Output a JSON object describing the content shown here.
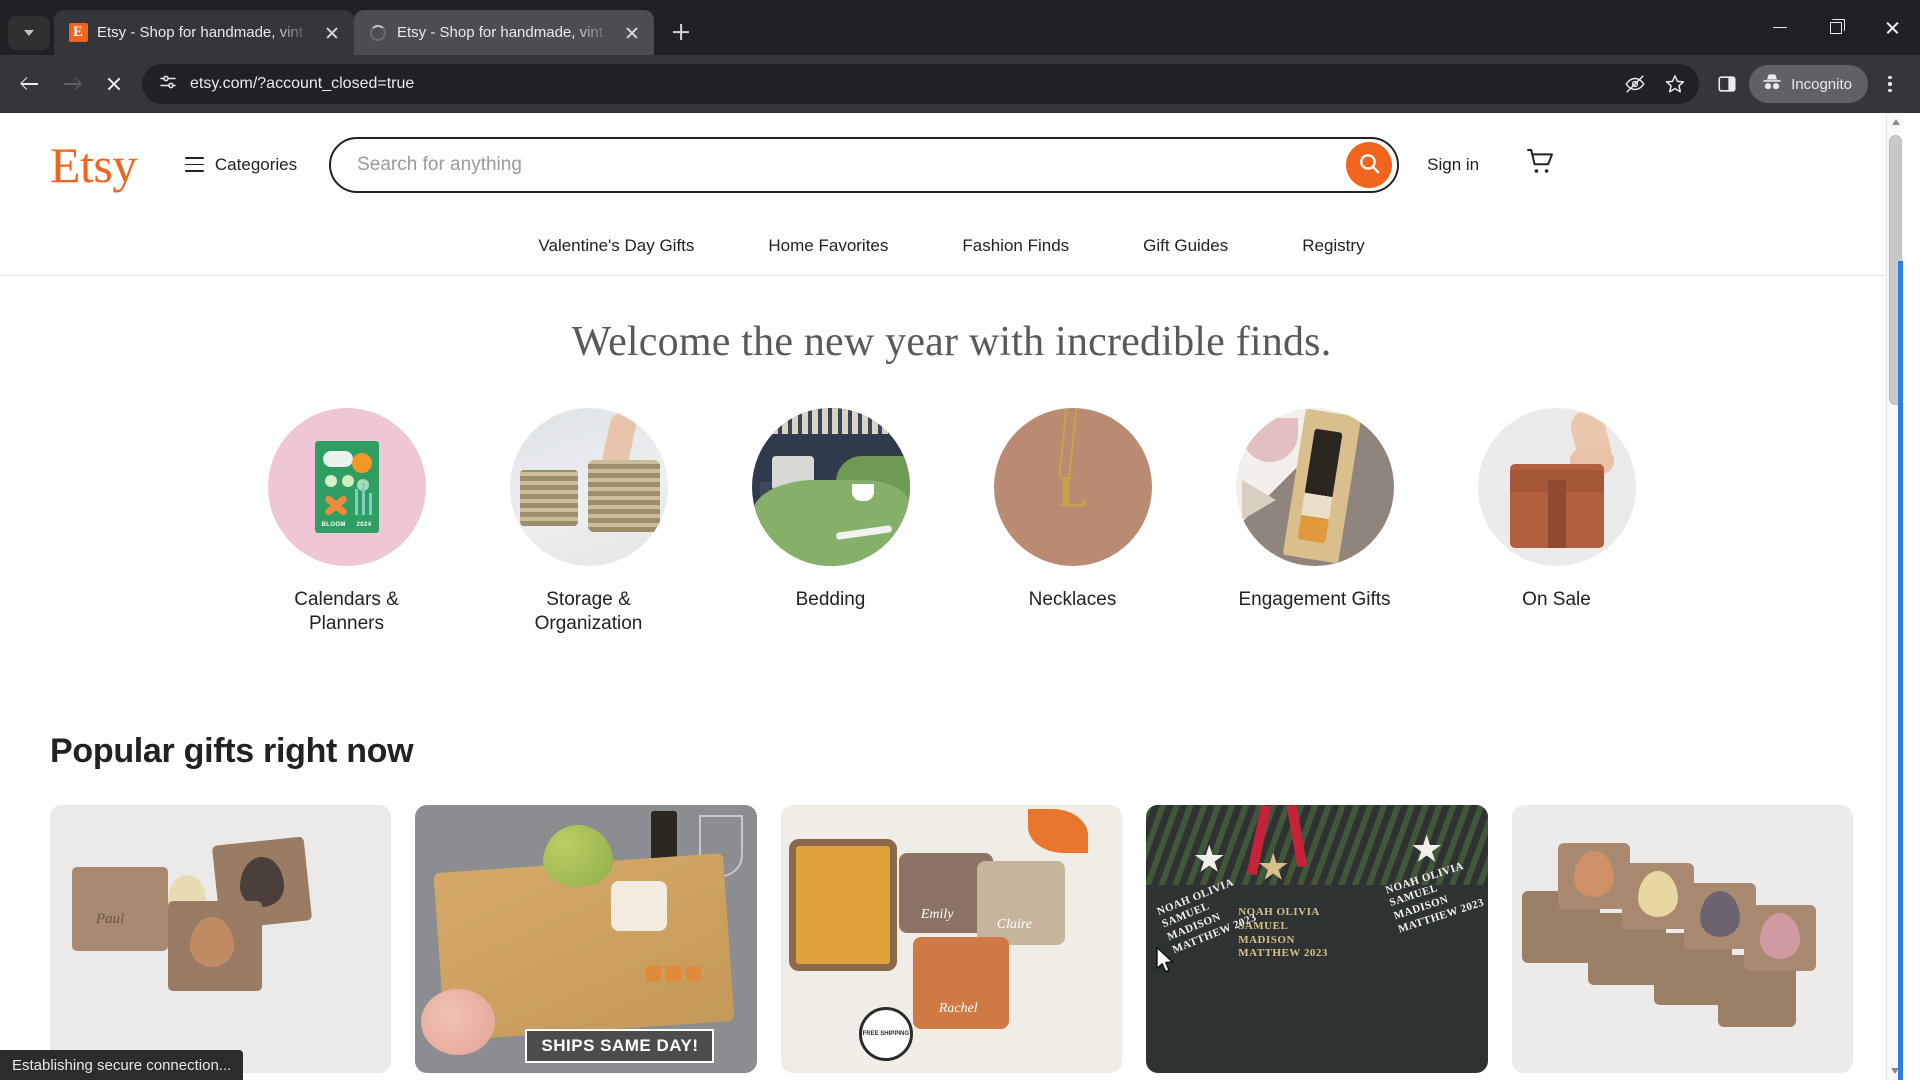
{
  "browser": {
    "tabs": [
      {
        "title": "Etsy - Shop for handmade, vint",
        "favicon": "etsy-favicon",
        "active": false
      },
      {
        "title": "Etsy - Shop for handmade, vint",
        "favicon": "loading-spinner",
        "active": true
      }
    ],
    "new_tab_label": "+",
    "url": "etsy.com/?account_closed=true",
    "omnibox_icons": [
      "site-settings-icon",
      "tracking-protection-icon",
      "bookmark-star-icon"
    ],
    "toolbar_icons": [
      "back-arrow",
      "forward-arrow",
      "stop-loading",
      "side-panel-icon",
      "menu-dots"
    ],
    "incognito_label": "Incognito",
    "window_controls": [
      "minimize",
      "maximize",
      "close"
    ],
    "status_text": "Establishing secure connection...",
    "accent": "#2f7fe0"
  },
  "site": {
    "logo": "Etsy",
    "logo_color": "#f1641e",
    "categories_label": "Categories",
    "search": {
      "placeholder": "Search for anything",
      "value": ""
    },
    "sign_in_label": "Sign in",
    "cart_label": "cart",
    "subnav": [
      {
        "label": "Valentine's Day Gifts"
      },
      {
        "label": "Home Favorites"
      },
      {
        "label": "Fashion Finds"
      },
      {
        "label": "Gift Guides"
      },
      {
        "label": "Registry"
      }
    ],
    "hero_title": "Welcome the new year with incredible finds.",
    "circles": [
      {
        "label": "Calendars & Planners",
        "art": "art-cal",
        "calendar_text": {
          "brand": "BLOOM",
          "year": "2024"
        }
      },
      {
        "label": "Storage & Organization",
        "art": "art-storage"
      },
      {
        "label": "Bedding",
        "art": "art-bed"
      },
      {
        "label": "Necklaces",
        "art": "art-neck",
        "pendant_letter": "L"
      },
      {
        "label": "Engagement Gifts",
        "art": "art-eng"
      },
      {
        "label": "On Sale",
        "art": "art-sale"
      }
    ],
    "popular_section_title": "Popular gifts right now",
    "products": [
      {
        "name": "",
        "art": "p1",
        "engraved_name": "Paul"
      },
      {
        "name": "",
        "art": "p2",
        "badge": "SHIPS SAME DAY!"
      },
      {
        "name": "",
        "art": "p3",
        "names": [
          "Emily",
          "Claire",
          "Rachel"
        ],
        "shipping_badge": "FREE SHIPPING"
      },
      {
        "name": "",
        "art": "p4",
        "ornament_text": "NOAH\nOLIVIA\nSAMUEL\nMADISON\nMATTHEW\n2023"
      },
      {
        "name": "",
        "art": "p5"
      }
    ]
  }
}
